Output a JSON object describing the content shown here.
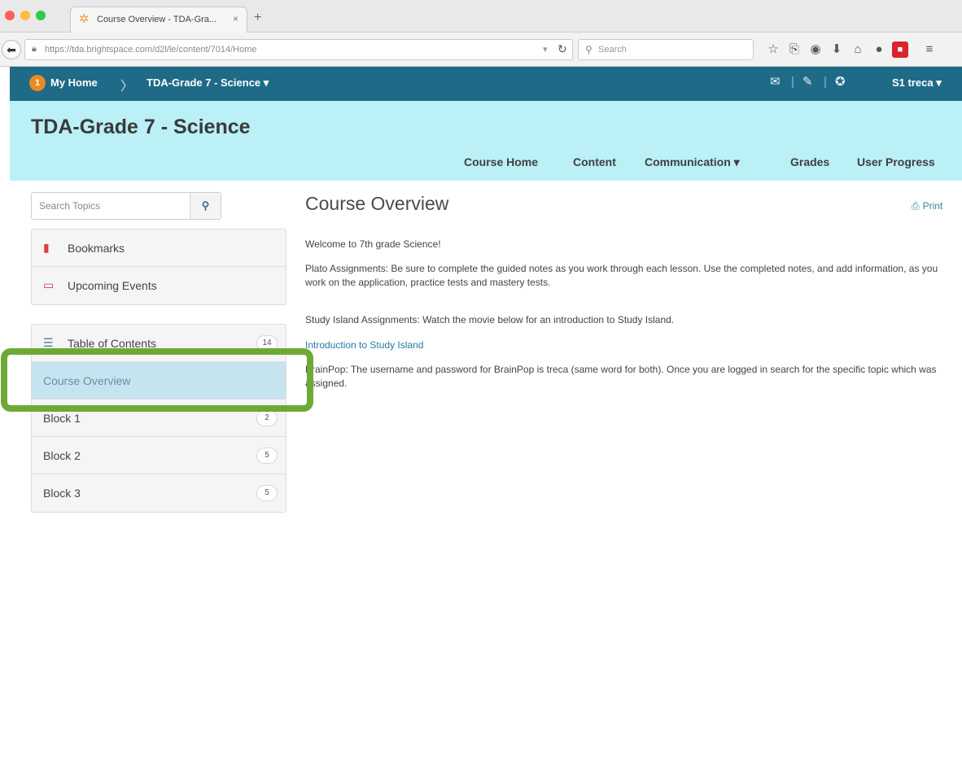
{
  "browser": {
    "tab_title": "Course Overview - TDA-Gra...",
    "tab_close": "×",
    "new_tab": "+",
    "url": "https://tda.brightspace.com/d2l/le/content/7014/Home",
    "search_placeholder": "Search"
  },
  "navbar": {
    "home_badge": "1",
    "my_home": "My Home",
    "course": "TDA-Grade 7 - Science ▾",
    "user": "S1 treca ▾"
  },
  "course_header": {
    "title": "TDA-Grade 7 - Science",
    "nav": [
      "Course Home",
      "Content",
      "Communication ▾",
      "Grades",
      "User Progress"
    ]
  },
  "sidebar": {
    "search_placeholder": "Search Topics",
    "bookmarks": "Bookmarks",
    "upcoming_events": "Upcoming Events",
    "toc_label": "Table of Contents",
    "toc_count": "14",
    "modules": [
      {
        "label": "Course Overview",
        "count": ""
      },
      {
        "label": "Block 1",
        "count": "2"
      },
      {
        "label": "Block 2",
        "count": "5"
      },
      {
        "label": "Block 3",
        "count": "5"
      }
    ]
  },
  "main": {
    "title": "Course Overview",
    "print": "Print",
    "paragraphs": [
      "Welcome to 7th grade Science!",
      "Plato Assignments:  Be sure to complete the guided notes as you work through each lesson. Use the completed notes, and add information, as you work on the application, practice tests and mastery tests.",
      "Study Island Assignments: Watch the movie below for an introduction to Study Island."
    ],
    "link": "Introduction to Study Island",
    "brainpop": "BrainPop: The username and password for BrainPop is treca   (same word for both). Once you are logged in search for the specific topic which was assigned."
  },
  "colors": {
    "navbar": "#1f6b87",
    "course_header": "#baf0f6",
    "highlight": "#6ea935",
    "selected_row": "#c6e3f0"
  }
}
